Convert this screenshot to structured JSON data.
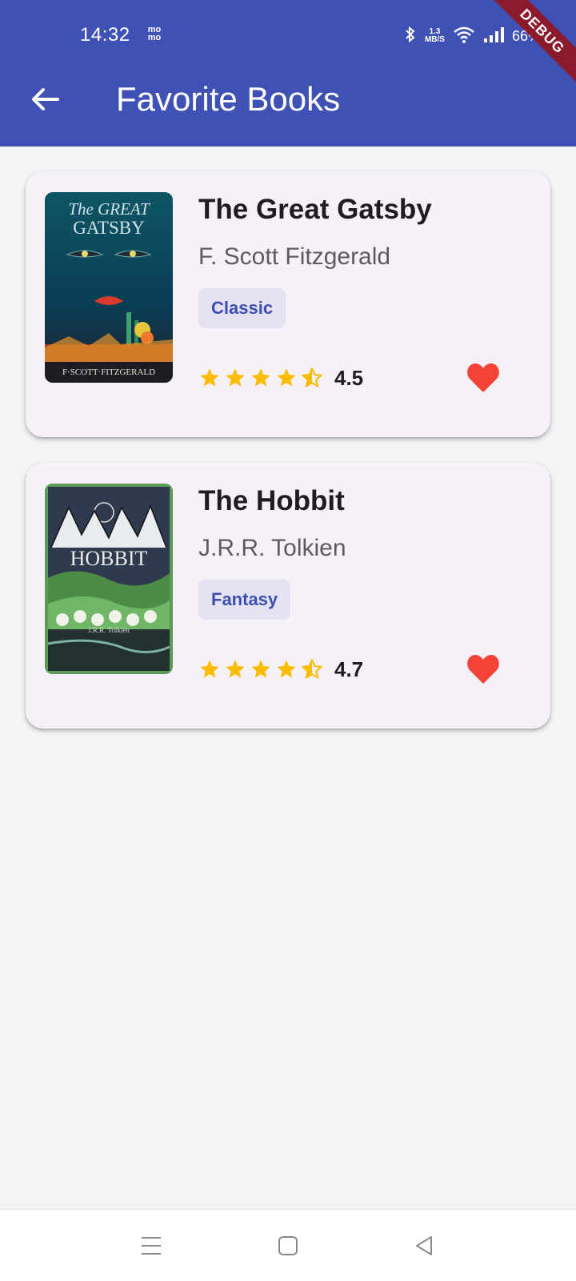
{
  "status_bar": {
    "time": "14:32",
    "carrier_badge_top": "mo",
    "carrier_badge_bottom": "mo",
    "speed_top": "1.3",
    "speed_bottom": "MB/S",
    "battery": "66%"
  },
  "debug_banner": "DEBUG",
  "app_bar": {
    "title": "Favorite Books",
    "back_icon": "arrow-back-icon"
  },
  "books": [
    {
      "title": "The Great Gatsby",
      "author": "F. Scott Fitzgerald",
      "genre": "Classic",
      "rating": "4.5",
      "rating_value": 4.5,
      "favorite": true,
      "cover_title_line1": "The GREAT",
      "cover_title_line2": "GATSBY",
      "cover_author": "F·SCOTT·FITZGERALD"
    },
    {
      "title": "The Hobbit",
      "author": "J.R.R. Tolkien",
      "genre": "Fantasy",
      "rating": "4.7",
      "rating_value": 4.7,
      "favorite": true,
      "cover_title_line1": "HOBBIT",
      "cover_author": "J.R.R. Tolkien"
    }
  ],
  "colors": {
    "app_bar": "#4051b5",
    "star": "#fbbc05",
    "heart": "#f44336",
    "chip_bg": "#e5e2f3",
    "chip_text": "#3d4fae"
  },
  "nav_bar": {
    "menu_icon": "menu-icon",
    "home_icon": "home-square-icon",
    "back_icon": "back-triangle-icon"
  }
}
